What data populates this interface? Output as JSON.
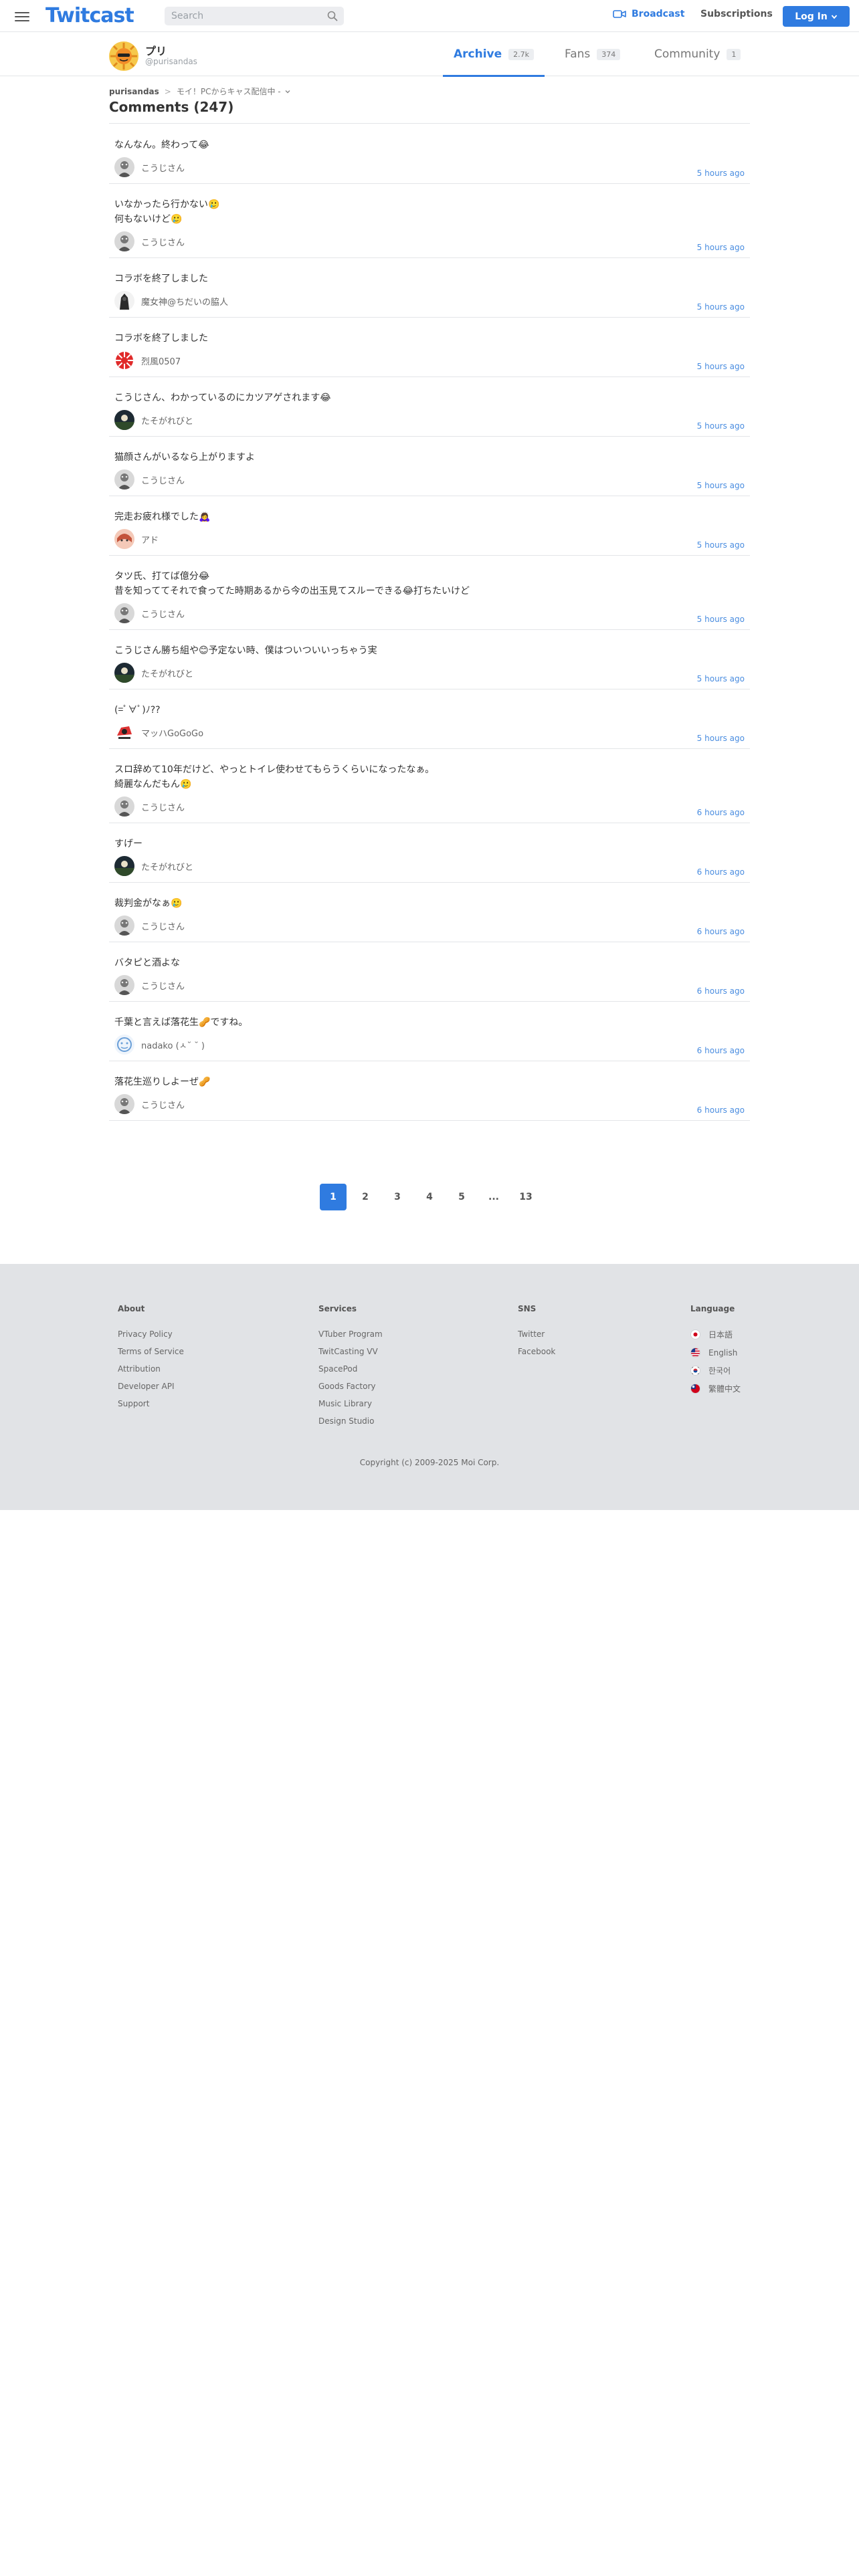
{
  "header": {
    "logo": "Twitcast",
    "search_placeholder": "Search",
    "broadcast_label": "Broadcast",
    "subscriptions_label": "Subscriptions",
    "login_label": "Log In",
    "accent_color": "#2f7be0"
  },
  "profile": {
    "name": "プリ",
    "handle": "@purisandas",
    "tabs": [
      {
        "label": "Archive",
        "count": "2.7k"
      },
      {
        "label": "Fans",
        "count": "374"
      },
      {
        "label": "Community",
        "count": "1"
      }
    ]
  },
  "breadcrumb": {
    "user": "purisandas",
    "movie": "モイ！PCからキャス配信中 -"
  },
  "page_title": "Comments (247)",
  "comments": [
    {
      "text": "なんなん。終わって😂",
      "author": "こうじさん",
      "time": "5 hours ago",
      "avatar": "gray"
    },
    {
      "text": "いなかったら行かない🥲\n何もないけど🥲",
      "author": "こうじさん",
      "time": "5 hours ago",
      "avatar": "gray"
    },
    {
      "text": "コラボを終了しました",
      "author": "魔女神@ちだいの脇人",
      "time": "5 hours ago",
      "avatar": "dark"
    },
    {
      "text": "コラボを終了しました",
      "author": "烈風0507",
      "time": "5 hours ago",
      "avatar": "red"
    },
    {
      "text": "こうじさん、わかっているのにカツアゲされます😂",
      "author": "たそがれびと",
      "time": "5 hours ago",
      "avatar": "dusk"
    },
    {
      "text": "猫顔さんがいるなら上がりますよ",
      "author": "こうじさん",
      "time": "5 hours ago",
      "avatar": "gray"
    },
    {
      "text": "完走お疲れ様でした🙇‍♀️",
      "author": "アド",
      "time": "5 hours ago",
      "avatar": "anime"
    },
    {
      "text": "タツ氏、打てば億分😂\n昔を知っててそれで食ってた時期あるから今の出玉見てスルーできる😂打ちたいけど",
      "author": "こうじさん",
      "time": "5 hours ago",
      "avatar": "gray"
    },
    {
      "text": "こうじさん勝ち組や😊予定ない時、僕はついついいっちゃう実",
      "author": "たそがれびと",
      "time": "5 hours ago",
      "avatar": "dusk"
    },
    {
      "text": "(=ﾟ∀ﾟ)ﾉ??",
      "author": "マッハGoGoGo",
      "time": "5 hours ago",
      "avatar": "racer"
    },
    {
      "text": "スロ辞めて10年だけど、やっとトイレ使わせてもらうくらいになったなぁ。\n綺麗なんだもん🥲",
      "author": "こうじさん",
      "time": "6 hours ago",
      "avatar": "gray"
    },
    {
      "text": "すげー",
      "author": "たそがれびと",
      "time": "6 hours ago",
      "avatar": "dusk"
    },
    {
      "text": "裁判金がなぁ🥲",
      "author": "こうじさん",
      "time": "6 hours ago",
      "avatar": "gray"
    },
    {
      "text": "バタピと酒よな",
      "author": "こうじさん",
      "time": "6 hours ago",
      "avatar": "gray"
    },
    {
      "text": "千葉と言えば落花生🥜ですね。",
      "author": "nadako (ㅅ˘ ˘ )",
      "time": "6 hours ago",
      "avatar": "blue"
    },
    {
      "text": "落花生巡りしよーぜ🥜",
      "author": "こうじさん",
      "time": "6 hours ago",
      "avatar": "gray"
    }
  ],
  "pagination": {
    "pages": [
      "1",
      "2",
      "3",
      "4",
      "5",
      "...",
      "13"
    ],
    "current": "1"
  },
  "footer": {
    "about": {
      "heading": "About",
      "links": [
        "Privacy Policy",
        "Terms of Service",
        "Attribution",
        "Developer API",
        "Support"
      ]
    },
    "services": {
      "heading": "Services",
      "links": [
        "VTuber Program",
        "TwitCasting VV",
        "SpacePod",
        "Goods Factory",
        "Music Library",
        "Design Studio"
      ]
    },
    "sns": {
      "heading": "SNS",
      "links": [
        "Twitter",
        "Facebook"
      ]
    },
    "language": {
      "heading": "Language",
      "items": [
        {
          "label": "日本語",
          "flag": "jp"
        },
        {
          "label": "English",
          "flag": "us"
        },
        {
          "label": "한국어",
          "flag": "kr"
        },
        {
          "label": "繁體中文",
          "flag": "tw"
        }
      ]
    },
    "copyright": "Copyright (c) 2009-2025 Moi Corp."
  }
}
